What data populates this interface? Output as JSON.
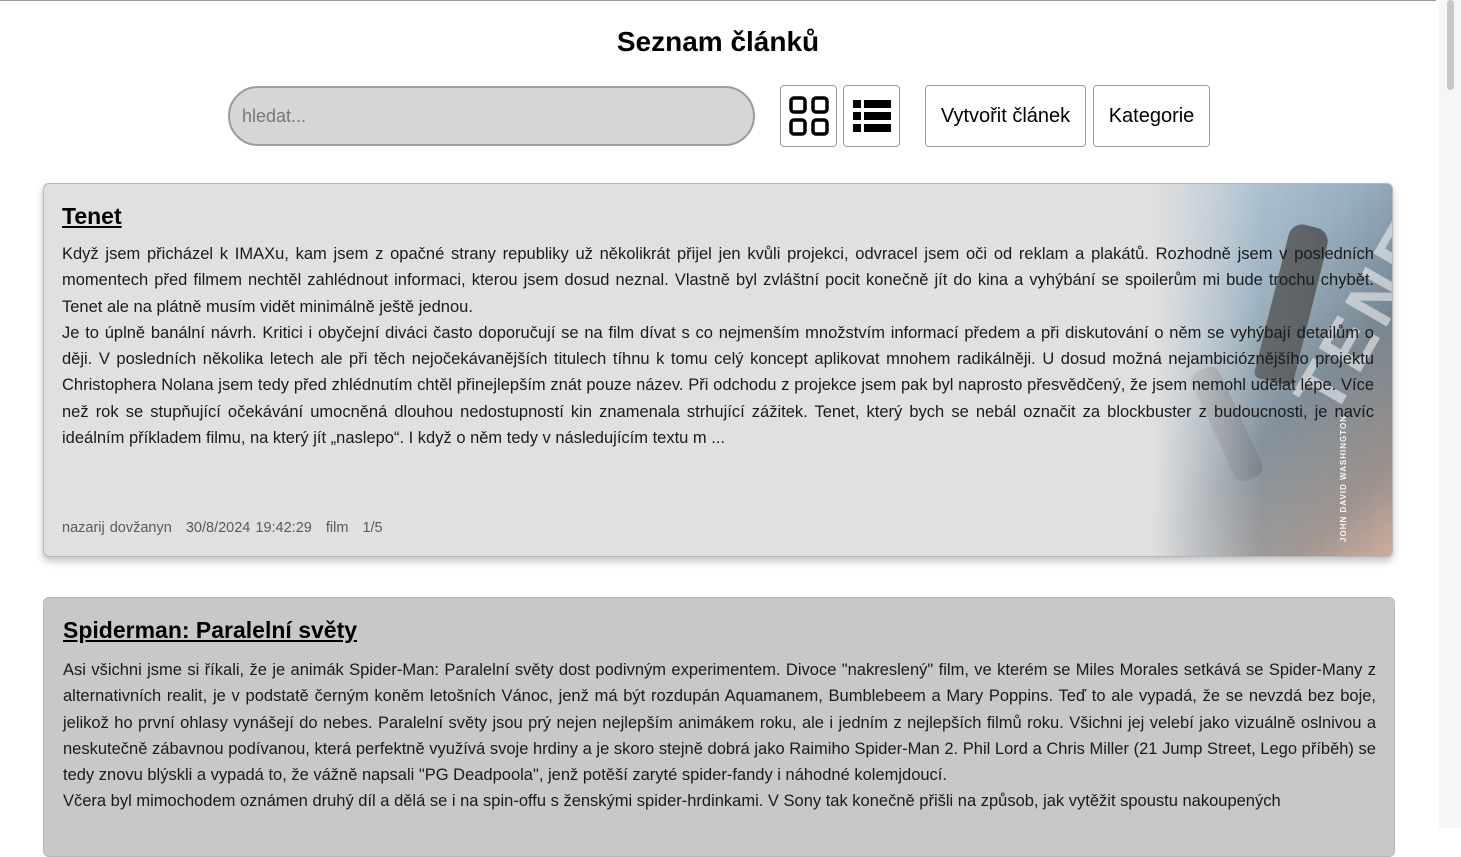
{
  "page": {
    "title": "Seznam článků"
  },
  "toolbar": {
    "search_placeholder": "hledat...",
    "grid_view_icon": "grid-icon",
    "list_view_icon": "list-icon",
    "create_label": "Vytvořit článek",
    "categories_label": "Kategorie"
  },
  "articles": [
    {
      "title": "Tenet",
      "paragraphs": [
        "Když jsem přicházel k IMAXu, kam jsem z opačné strany republiky už několikrát přijel jen kvůli projekci, odvracel jsem oči od reklam a plakátů. Rozhodně jsem v posledních momentech před filmem nechtěl zahlédnout informaci, kterou jsem dosud neznal. Vlastně byl zvláštní pocit konečně jít do kina a vyhýbání se spoilerům mi bude trochu chybět. Tenet ale na plátně musím vidět minimálně ještě jednou.",
        "Je to úplně banální návrh. Kritici i obyčejní diváci často doporučují se na film dívat s co nejmenším množstvím informací předem a při diskutování o něm se vyhýbají detailům o ději. V posledních několika letech ale při těch nejočekávanějších titulech tíhnu k tomu celý koncept aplikovat mnohem radikálněji. U dosud možná nejambicióznějšího projektu Christophera Nolana jsem tedy před zhlédnutím chtěl přinejlepším znát pouze název. Při odchodu z projekce jsem pak byl naprosto přesvědčený, že jsem nemohl udělat lépe. Více než rok se stupňující očekávání umocněná dlouhou nedostupností kin znamenala strhující zážitek. Tenet, který bych se nebál označit za blockbuster z budoucnosti, je navíc ideálním příkladem filmu, na který jít „naslepo“. I když o něm tedy v následujícím textu m ..."
      ],
      "author": "nazarij dovžanyn",
      "date": "30/8/2024 19:42:29",
      "category": "film",
      "rating": "1/5",
      "poster_title": "TENET",
      "poster_credit": "JOHN DAVID WASHINGTON"
    },
    {
      "title": "Spiderman: Paralelní světy",
      "paragraphs": [
        "Asi všichni jsme si říkali, že je animák Spider-Man: Paralelní světy dost podivným experimentem. Divoce \"nakreslený\" film, ve kterém se Miles Morales setkává se Spider-Many z alternativních realit, je v podstatě černým koněm letošních Vánoc, jenž má být rozdupán Aquamanem, Bumblebeem a Mary Poppins. Teď to ale vypadá, že se nevzdá bez boje, jelikož ho první ohlasy vynášejí do nebes. Paralelní světy jsou prý nejen nejlepším animákem roku, ale i jedním z nejlepších filmů roku. Všichni jej velebí jako vizuálně oslnivou a neskutečně zábavnou podívanou, která perfektně využívá svoje hrdiny a je skoro stejně dobrá jako Raimiho Spider-Man 2. Phil Lord a Chris Miller (21 Jump Street, Lego příběh) se tedy znovu blýskli a vypadá to, že vážně napsali \"PG Deadpoola\", jenž potěší zaryté spider-fandy i náhodné kolemjdoucí.",
        "Včera byl mimochodem oznámen druhý díl a dělá se i na spin-offu s ženskými spider-hrdinkami. V Sony tak konečně přišli na způsob, jak vytěžit spoustu nakoupených"
      ]
    }
  ]
}
